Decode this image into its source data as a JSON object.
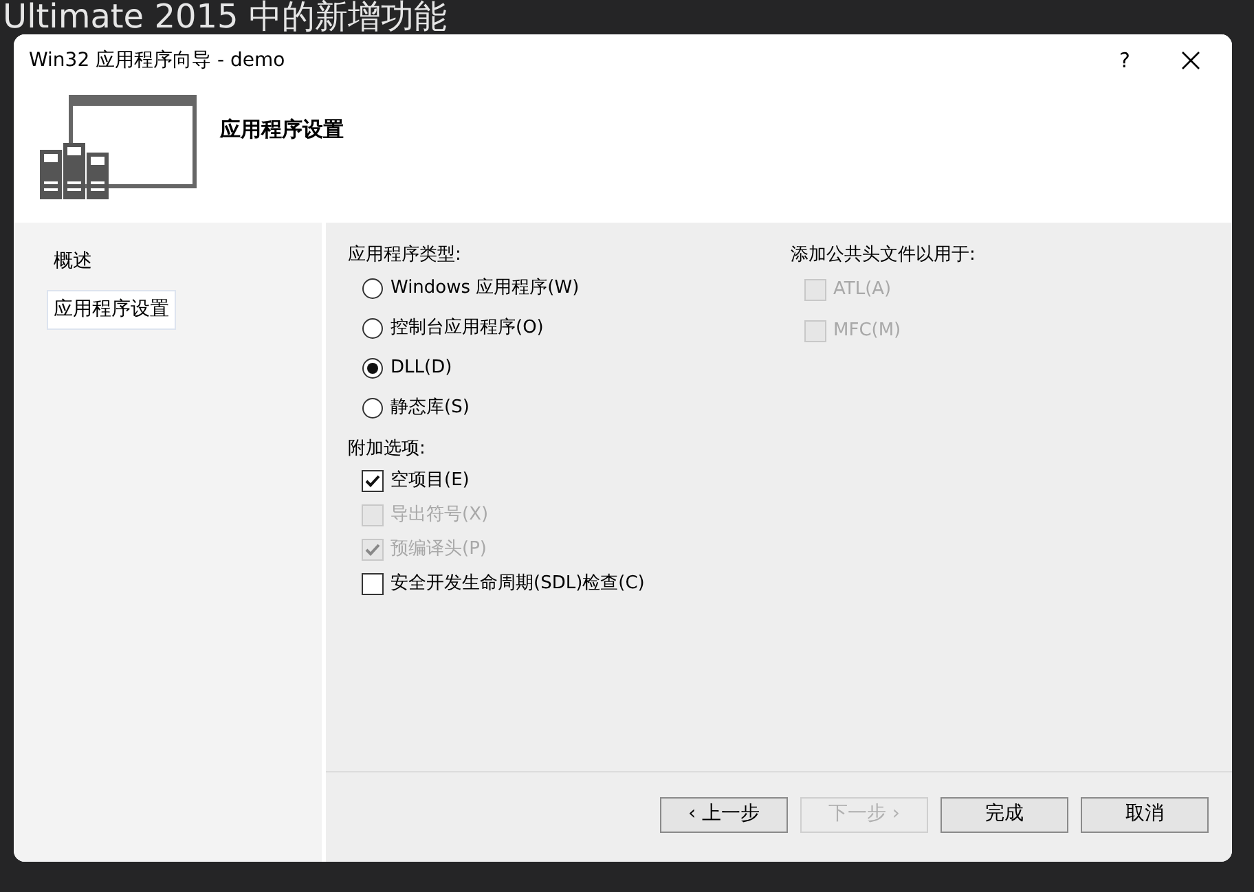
{
  "background": {
    "heading": "Ultimate 2015 中的新增功能"
  },
  "dialog": {
    "title": "Win32 应用程序向导 - demo",
    "help": "?",
    "header": "应用程序设置",
    "nav": [
      {
        "label": "概述",
        "selected": false
      },
      {
        "label": "应用程序设置",
        "selected": true
      }
    ],
    "app_type": {
      "label": "应用程序类型:",
      "options": [
        {
          "label": "Windows 应用程序(W)",
          "selected": false
        },
        {
          "label": "控制台应用程序(O)",
          "selected": false
        },
        {
          "label": "DLL(D)",
          "selected": true
        },
        {
          "label": "静态库(S)",
          "selected": false
        }
      ]
    },
    "additional": {
      "label": "附加选项:",
      "options": [
        {
          "label": "空项目(E)",
          "checked": true,
          "disabled": false
        },
        {
          "label": "导出符号(X)",
          "checked": false,
          "disabled": true
        },
        {
          "label": "预编译头(P)",
          "checked": true,
          "disabled": true
        },
        {
          "label": "安全开发生命周期(SDL)检查(C)",
          "checked": false,
          "disabled": false
        }
      ]
    },
    "common_headers": {
      "label": "添加公共头文件以用于:",
      "options": [
        {
          "label": "ATL(A)",
          "checked": false,
          "disabled": true
        },
        {
          "label": "MFC(M)",
          "checked": false,
          "disabled": true
        }
      ]
    },
    "buttons": [
      {
        "label": "‹ 上一步",
        "disabled": false
      },
      {
        "label": "下一步 ›",
        "disabled": true
      },
      {
        "label": "完成",
        "disabled": false
      },
      {
        "label": "取消",
        "disabled": false
      }
    ]
  }
}
